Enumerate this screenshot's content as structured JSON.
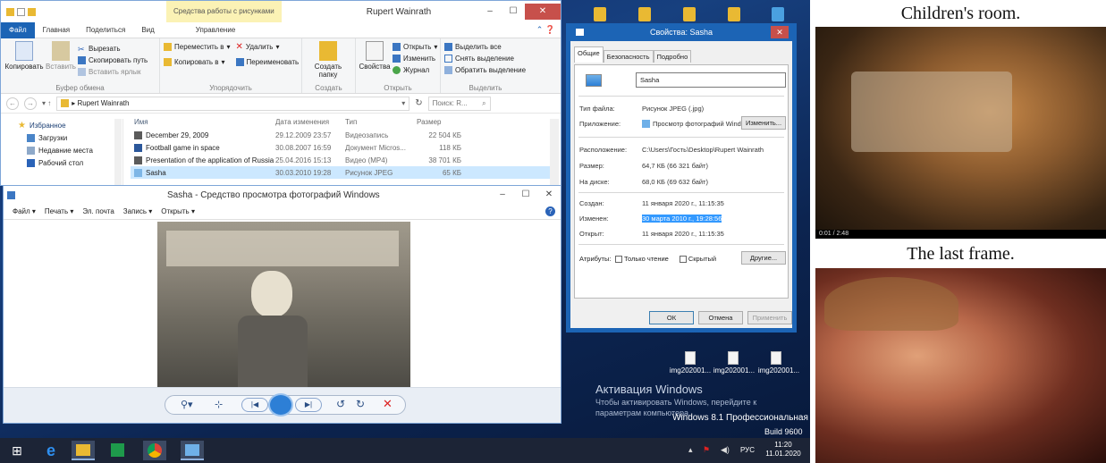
{
  "explorer": {
    "context_tab": "Средства работы с рисунками",
    "title": "Rupert Wainrath",
    "tabs": [
      "Файл",
      "Главная",
      "Поделиться",
      "Вид",
      "Управление"
    ],
    "clipboard": {
      "copy": "Копировать",
      "paste": "Вставить",
      "cut": "Вырезать",
      "copy_path": "Скопировать путь",
      "paste_shortcut": "Вставить ярлык",
      "group": "Буфер обмена"
    },
    "organize": {
      "move": "Переместить в",
      "copy": "Копировать в",
      "delete": "Удалить",
      "rename": "Переименовать",
      "group": "Упорядочить"
    },
    "create": {
      "new_folder": "Создать папку",
      "group": "Создать"
    },
    "open": {
      "properties": "Свойства",
      "open": "Открыть",
      "edit": "Изменить",
      "history": "Журнал",
      "group": "Открыть"
    },
    "select": {
      "all": "Выделить все",
      "none": "Снять выделение",
      "invert": "Обратить выделение",
      "group": "Выделить"
    },
    "path": "Rupert Wainrath",
    "search_placeholder": "Поиск: R...",
    "nav": [
      "Избранное",
      "Загрузки",
      "Недавние места",
      "Рабочий стол"
    ],
    "columns": [
      "Имя",
      "Дата изменения",
      "Тип",
      "Размер"
    ],
    "files": [
      {
        "name": "December 29, 2009",
        "date": "29.12.2009 23:57",
        "type": "Видеозапись",
        "size": "22 504 КБ"
      },
      {
        "name": "Football game in space",
        "date": "30.08.2007 16:59",
        "type": "Документ Micros...",
        "size": "118 КБ"
      },
      {
        "name": "Presentation of the application of Russia",
        "date": "25.04.2016 15:13",
        "type": "Видео (MP4)",
        "size": "38 701 КБ"
      },
      {
        "name": "Sasha",
        "date": "30.03.2010 19:28",
        "type": "Рисунок JPEG",
        "size": "65 КБ"
      }
    ]
  },
  "viewer": {
    "title": "Sasha - Средство просмотра фотографий Windows",
    "menu": [
      "Файл",
      "Печать",
      "Эл. почта",
      "Запись",
      "Открыть"
    ]
  },
  "props": {
    "title": "Свойства: Sasha",
    "tabs": [
      "Общие",
      "Безопасность",
      "Подробно"
    ],
    "name": "Sasha",
    "type_label": "Тип файла:",
    "type_value": "Рисунок JPEG (.jpg)",
    "app_label": "Приложение:",
    "app_value": "Просмотр фотографий Windows",
    "change_btn": "Изменить...",
    "location_label": "Расположение:",
    "location_value": "C:\\Users\\Гость\\Desktop\\Rupert Wainrath",
    "size_label": "Размер:",
    "size_value": "64,7 КБ (66 321 байт)",
    "disk_label": "На диске:",
    "disk_value": "68,0 КБ (69 632 байт)",
    "created_label": "Создан:",
    "created_value": "11 января 2020 г., 11:15:35",
    "modified_label": "Изменен:",
    "modified_value": "30 марта 2010 г., 19:28:56",
    "accessed_label": "Открыт:",
    "accessed_value": "11 января 2020 г., 11:15:35",
    "attr_label": "Атрибуты:",
    "readonly": "Только чтение",
    "hidden": "Скрытый",
    "other_btn": "Другие...",
    "ok": "ОК",
    "cancel": "Отмена",
    "apply": "Применить"
  },
  "desktop": {
    "files": [
      "img202001...",
      "img202001...",
      "img202001..."
    ],
    "activation_title": "Активация Windows",
    "activation_text": "Чтобы активировать Windows, перейдите к параметрам компьютера.",
    "edition": "Windows 8.1 Профессиональная",
    "build": "Build 9600"
  },
  "taskbar": {
    "lang": "РУС",
    "time": "11:20",
    "date": "11.01.2020"
  },
  "right": {
    "caption1": "Children's room.",
    "video_time": "0:01 / 2:48",
    "caption2": "The last frame."
  }
}
